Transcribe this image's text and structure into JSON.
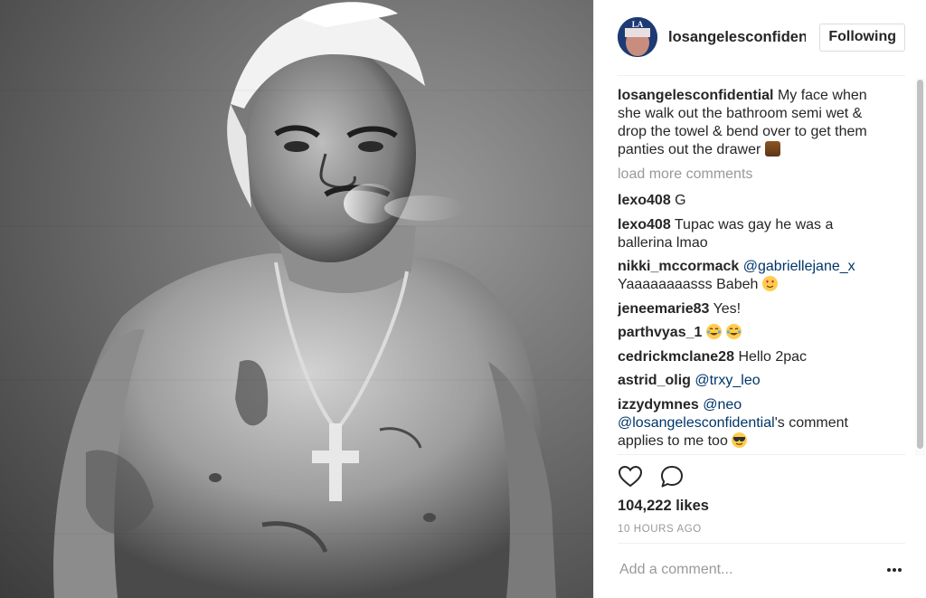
{
  "post": {
    "username": "losangelesconfident",
    "follow_label": "Following",
    "caption": {
      "author": "losangelesconfidential",
      "text": "My face when she walk out the bathroom semi wet & drop the towel & bend over to get them panties out the drawer",
      "emoji": "raising-hands-emoji"
    },
    "load_more_label": "load more comments",
    "comments": [
      {
        "author": "lexo408",
        "text": "G"
      },
      {
        "author": "lexo408",
        "text": "Tupac was gay he was a ballerina lmao"
      },
      {
        "author": "nikki_mccormack",
        "mention": "@gabriellejane_x",
        "text": "Yaaaaaaaasss Babeh",
        "emoji": "heart-eyes-emoji"
      },
      {
        "author": "jeneemarie83",
        "text": "Yes!"
      },
      {
        "author": "parthvyas_1",
        "emoji": "laughing-tears-emoji"
      },
      {
        "author": "cedrickmclane28",
        "text": "Hello 2pac"
      },
      {
        "author": "astrid_olig",
        "mention": "@trxy_leo"
      },
      {
        "author": "izzydymnes",
        "mention": "@neo",
        "mention2": "@losangelesconfidential",
        "text": "'s comment applies to me too",
        "emoji": "sunglasses-emoji"
      }
    ],
    "likes": "104,222 likes",
    "timestamp": "10 HOURS AGO",
    "comment_placeholder": "Add a comment..."
  },
  "icons": {
    "like": "heart-outline-icon",
    "comment": "comment-bubble-icon",
    "more": "more-options-icon"
  },
  "colors": {
    "text": "#262626",
    "muted": "#999999",
    "mention": "#003569",
    "border": "#dbdbdb"
  }
}
